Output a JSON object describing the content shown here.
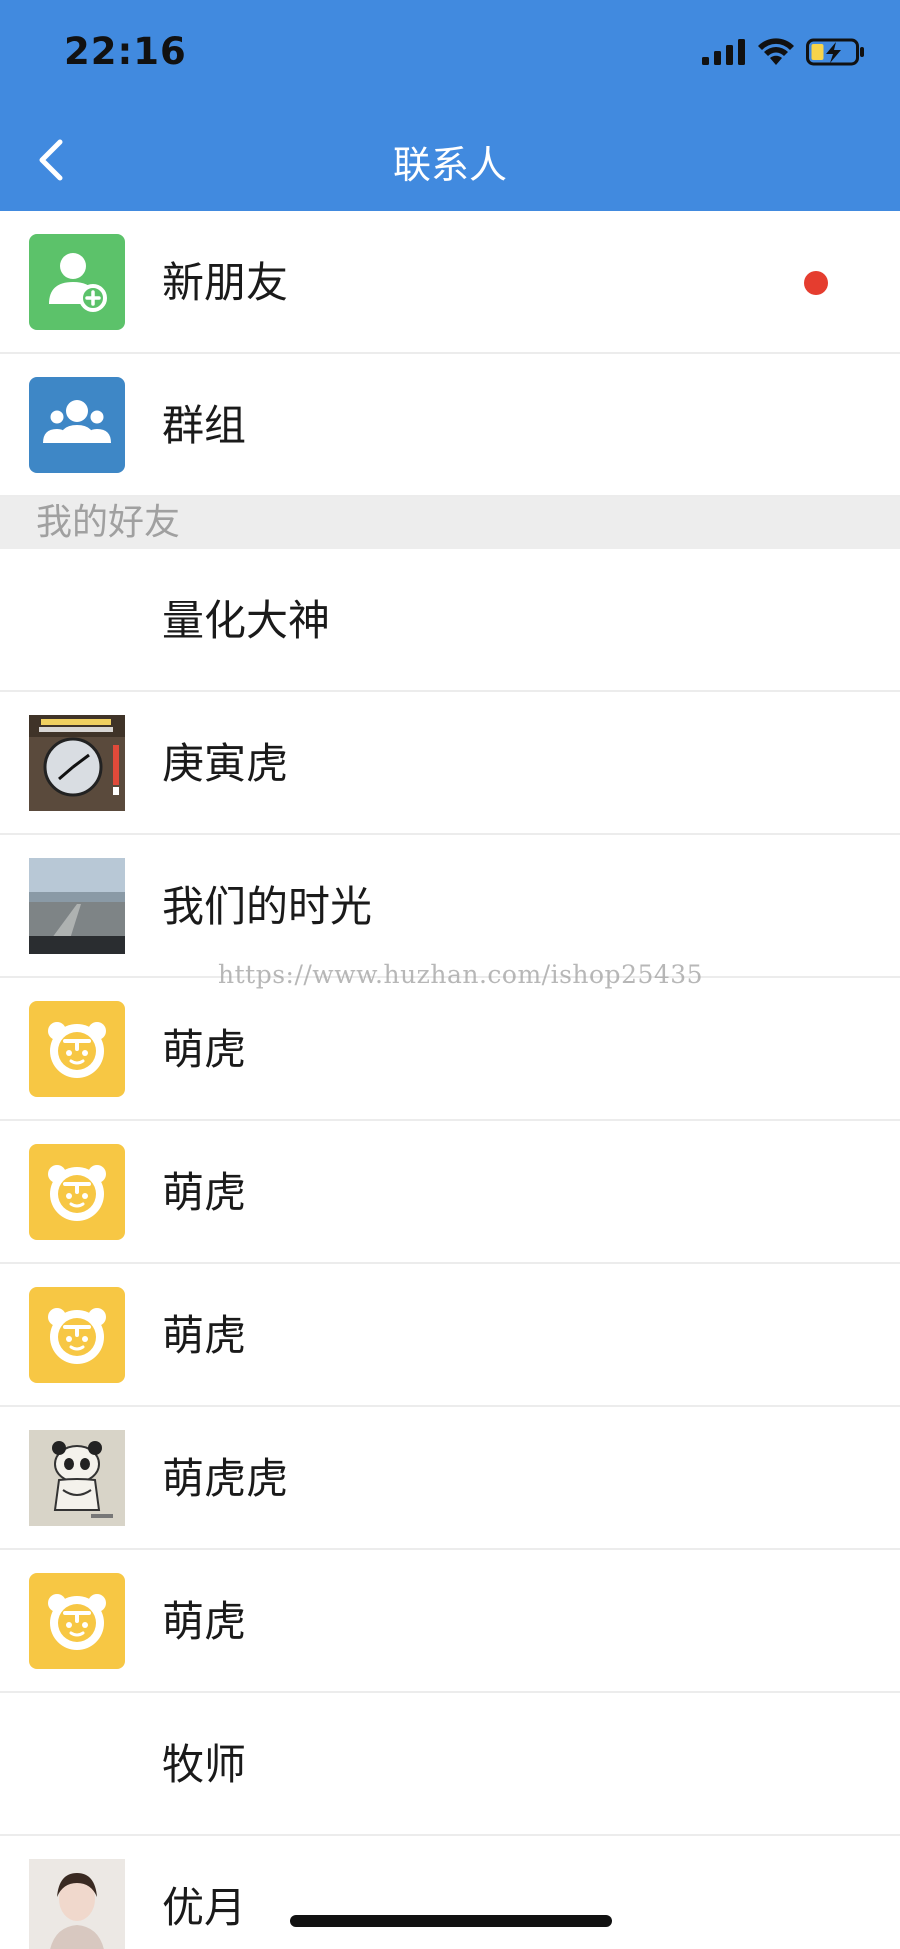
{
  "status_bar": {
    "time": "22:16"
  },
  "nav": {
    "title": "联系人",
    "back_icon": "chevron-left-icon"
  },
  "colors": {
    "header_bg": "#418ADF",
    "new_friend_icon_bg": "#5CC26A",
    "group_icon_bg": "#3E87C6",
    "tiger_icon_bg": "#F7C744",
    "unread_dot": "#E53D2F",
    "section_bg": "#EDEDED"
  },
  "top_items": [
    {
      "label": "新朋友",
      "icon": "add-user-icon",
      "unread": true
    },
    {
      "label": "群组",
      "icon": "group-icon",
      "unread": false
    }
  ],
  "section_title": "我的好友",
  "contacts": [
    {
      "name": "量化大神",
      "avatar": "none"
    },
    {
      "name": "庚寅虎",
      "avatar": "clock-photo"
    },
    {
      "name": "我们的时光",
      "avatar": "road-photo"
    },
    {
      "name": "萌虎",
      "avatar": "tiger-icon"
    },
    {
      "name": "萌虎",
      "avatar": "tiger-icon"
    },
    {
      "name": "萌虎",
      "avatar": "tiger-icon"
    },
    {
      "name": "萌虎虎",
      "avatar": "panda-drawing"
    },
    {
      "name": "萌虎",
      "avatar": "tiger-icon"
    },
    {
      "name": "牧师",
      "avatar": "none"
    },
    {
      "name": "优月",
      "avatar": "portrait-photo"
    }
  ],
  "watermark": "https://www.huzhan.com/ishop25435"
}
